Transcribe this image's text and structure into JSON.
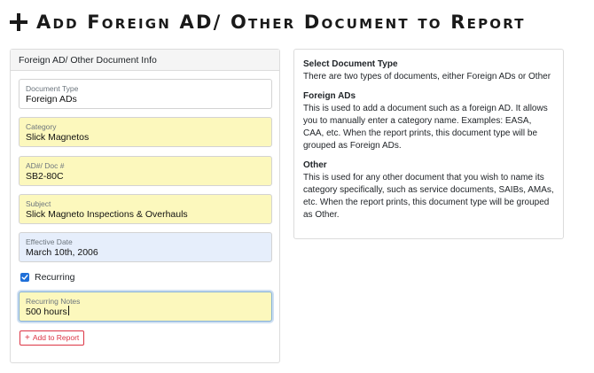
{
  "header": {
    "icon": "plus-icon",
    "title": "Add Foreign AD/ Other Document to Report"
  },
  "form": {
    "card_title": "Foreign AD/ Other Document Info",
    "fields": [
      {
        "label": "Document Type",
        "value": "Foreign ADs",
        "style": "plain"
      },
      {
        "label": "Category",
        "value": "Slick Magnetos",
        "style": "required"
      },
      {
        "label": "AD#/ Doc #",
        "value": "SB2-80C",
        "style": "required"
      },
      {
        "label": "Subject",
        "value": "Slick Magneto Inspections & Overhauls",
        "style": "required"
      },
      {
        "label": "Effective Date",
        "value": "March 10th, 2006",
        "style": "date"
      }
    ],
    "recurring": {
      "label": "Recurring",
      "checked": true
    },
    "recurring_notes": {
      "label": "Recurring Notes",
      "value": "500 hours",
      "focused": true
    },
    "add_button_label": "Add to Report"
  },
  "info": {
    "sections": [
      {
        "heading": "Select Document Type",
        "body": "There are two types of documents, either Foreign ADs or Other"
      },
      {
        "heading": "Foreign ADs",
        "body": "This is used to add a document such as a foreign AD. It allows you to manually enter a category name. Examples: EASA, CAA, etc. When the report prints, this document type will be grouped as Foreign ADs."
      },
      {
        "heading": "Other",
        "body": "This is used for any other document that you wish to name its category specifically, such as service documents, SAIBs, AMAs, etc. When the report prints, this document type will be grouped as Other."
      }
    ]
  },
  "colors": {
    "required_field_bg": "#fcf8bd",
    "date_field_bg": "#e6eefb",
    "checkbox_accent": "#1f6fd8",
    "button_danger": "#dc3545"
  }
}
